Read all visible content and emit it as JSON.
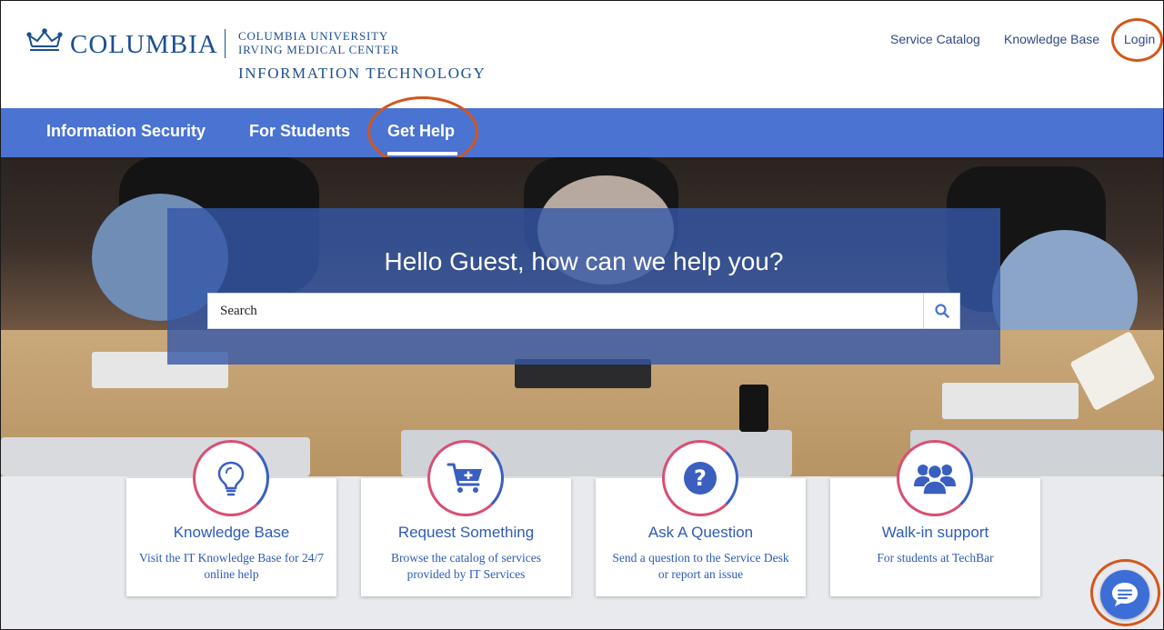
{
  "brand": {
    "wordmark": "COLUMBIA",
    "sub_line1": "Columbia University",
    "sub_line2": "Irving Medical Center",
    "sub_line3": "Information Technology",
    "color": "#1d4f91"
  },
  "top_links": {
    "service_catalog": "Service Catalog",
    "knowledge_base": "Knowledge Base",
    "login": "Login"
  },
  "nav": {
    "items": [
      "Information Security",
      "For Students",
      "Get Help"
    ],
    "active": "Get Help",
    "background": "#4a73d2"
  },
  "hero": {
    "title": "Hello Guest, how can we help you?",
    "search_placeholder": "Search"
  },
  "cards": [
    {
      "title": "Knowledge Base",
      "description": "Visit the IT Knowledge Base for 24/7 online help",
      "icon": "lightbulb-icon"
    },
    {
      "title": "Request Something",
      "description": "Browse the catalog of services provided by IT Services",
      "icon": "cart-plus-icon"
    },
    {
      "title": "Ask A Question",
      "description": "Send a question to the Service Desk or report an issue",
      "icon": "question-circle-icon"
    },
    {
      "title": "Walk-in support",
      "description": "For students at TechBar",
      "icon": "users-icon"
    }
  ],
  "colors": {
    "accent": "#2d5bb8",
    "highlight_ring": "#d4561c",
    "icon_ring_pink": "#d94f73",
    "icon_ring_blue": "#3a5fbf"
  },
  "chat": {
    "icon": "chat-bubble-icon"
  }
}
